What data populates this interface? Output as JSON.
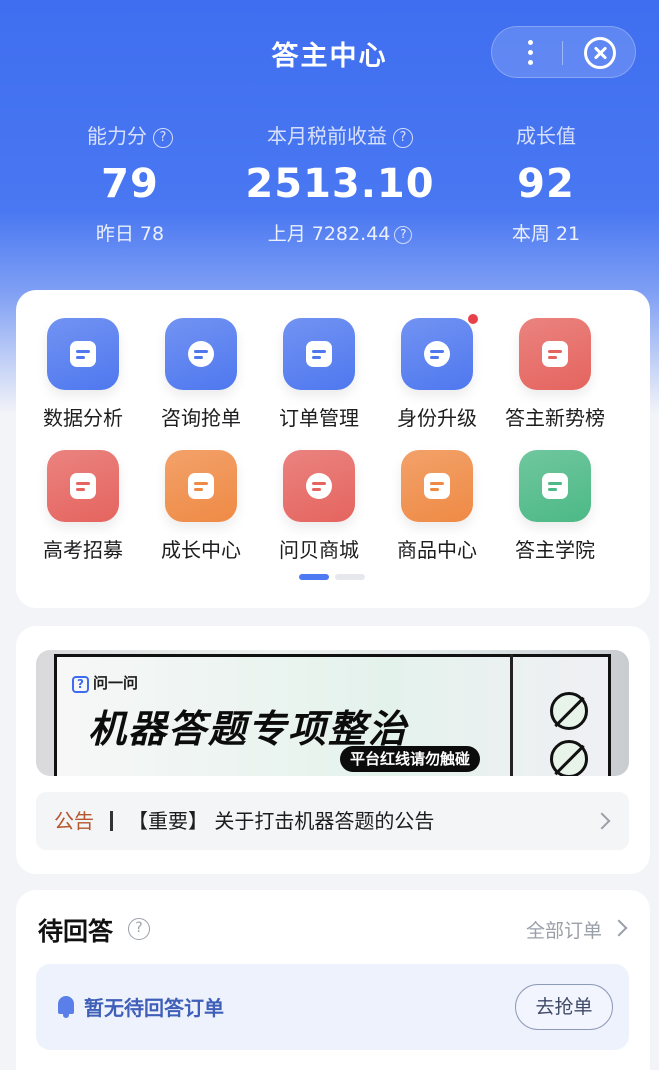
{
  "header": {
    "title": "答主中心"
  },
  "stats": [
    {
      "label": "能力分",
      "value": "79",
      "sub": "昨日 78",
      "has_help": true,
      "sub_help": false
    },
    {
      "label": "本月税前收益",
      "value": "2513.10",
      "sub": "上月 7282.44",
      "has_help": true,
      "sub_help": true
    },
    {
      "label": "成长值",
      "value": "92",
      "sub": "本周 21",
      "has_help": false,
      "sub_help": false
    }
  ],
  "grid": {
    "items": [
      {
        "label": "数据分析",
        "icon": "chart-icon",
        "color": "#4f78ef"
      },
      {
        "label": "咨询抢单",
        "icon": "lightning-icon",
        "color": "#4f78ef"
      },
      {
        "label": "订单管理",
        "icon": "document-icon",
        "color": "#4f78ef"
      },
      {
        "label": "身份升级",
        "icon": "user-badge-icon",
        "color": "#4f78ef",
        "badge": true
      },
      {
        "label": "答主新势榜",
        "icon": "trophy-icon",
        "color": "#e5645f"
      },
      {
        "label": "高考招募",
        "icon": "flag-icon",
        "color": "#e5645f"
      },
      {
        "label": "成长中心",
        "icon": "crown-icon",
        "color": "#ef8a45"
      },
      {
        "label": "问贝商城",
        "icon": "shell-icon",
        "color": "#e5645f"
      },
      {
        "label": "商品中心",
        "icon": "store-icon",
        "color": "#ef8a45"
      },
      {
        "label": "答主学院",
        "icon": "play-icon",
        "color": "#4cb986"
      }
    ]
  },
  "banner": {
    "brand": "问一问",
    "headline": "机器答题专项整治",
    "pill": "平台红线请勿触碰"
  },
  "notice": {
    "tag": "公告",
    "text": "【重要】 关于打击机器答题的公告"
  },
  "pending": {
    "title": "待回答",
    "all_orders": "全部订单",
    "empty_text": "暂无待回答订单",
    "grab_button": "去抢单"
  }
}
